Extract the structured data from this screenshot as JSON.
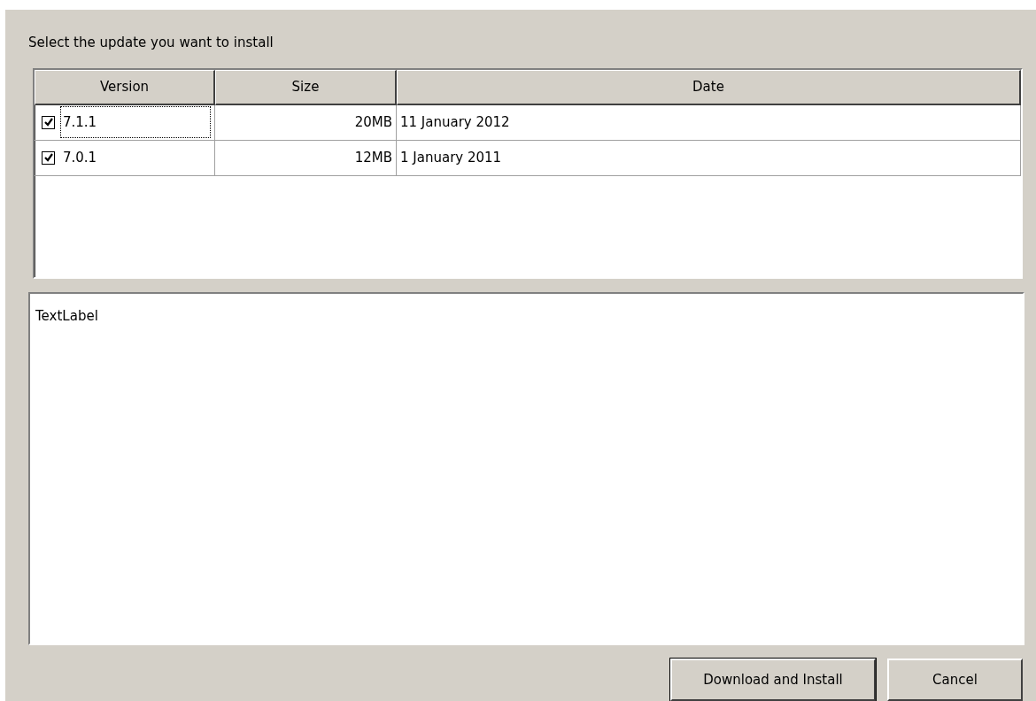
{
  "prompt": "Select the update you want to install",
  "table": {
    "columns": [
      "Version",
      "Size",
      "Date"
    ],
    "rows": [
      {
        "checked": true,
        "focused": true,
        "version": "7.1.1",
        "size": "20MB",
        "date": "11 January 2012"
      },
      {
        "checked": true,
        "focused": false,
        "version": "7.0.1",
        "size": "12MB",
        "date": "1 January 2011"
      }
    ]
  },
  "details": {
    "text": "TextLabel"
  },
  "buttons": [
    {
      "label": "Download and Install",
      "default": true
    },
    {
      "label": "Cancel",
      "default": false
    }
  ]
}
